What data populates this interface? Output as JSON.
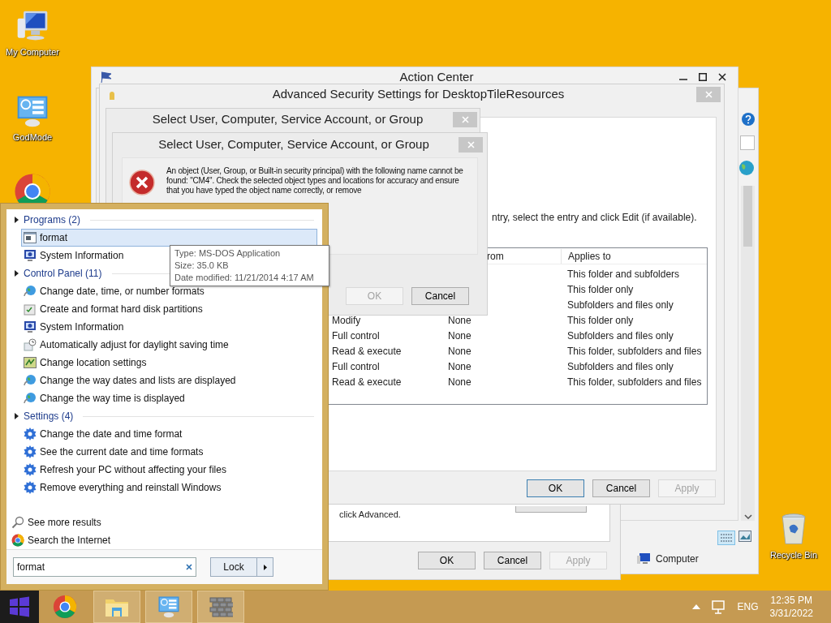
{
  "desktop_icons": [
    {
      "kind": "computer",
      "label": "My Computer"
    },
    {
      "kind": "godmode",
      "label": "GodMode"
    },
    {
      "kind": "chrome"
    },
    {
      "kind": "recycle",
      "label": "Recycle Bin"
    }
  ],
  "explorer_window": {
    "status_item": "Computer"
  },
  "action_center": {
    "title": "Action Center"
  },
  "properties_dialog": {
    "text": "click Advanced.",
    "buttons": [
      {
        "label": "OK",
        "disabled": false,
        "default": false
      },
      {
        "label": "Cancel",
        "disabled": false,
        "default": false
      },
      {
        "label": "Apply",
        "disabled": true,
        "default": false
      }
    ]
  },
  "advanced_security": {
    "title": "Advanced Security Settings for DesktopTileResources",
    "instruction": "ntry, select the entry and click Edit (if available).",
    "table": {
      "columns": [
        "rom",
        "Applies to"
      ],
      "rows": [
        {
          "applies_to": "This folder and subfolders"
        },
        {
          "applies_to": "This folder only"
        },
        {
          "applies_to": "Subfolders and files only"
        },
        {
          "access": "Modify",
          "inherited": "None",
          "applies_to": "This folder only"
        },
        {
          "access": "Full control",
          "inherited": "None",
          "applies_to": "Subfolders and files only"
        },
        {
          "access": "Read & execute",
          "inherited": "None",
          "applies_to": "This folder, subfolders and files"
        },
        {
          "access": "Full control",
          "inherited": "None",
          "applies_to": "Subfolders and files only"
        },
        {
          "access": "Read & execute",
          "inherited": "None",
          "applies_to": "This folder, subfolders and files"
        }
      ]
    },
    "buttons": [
      {
        "label": "OK",
        "disabled": false,
        "default": true
      },
      {
        "label": "Cancel",
        "disabled": false,
        "default": false
      },
      {
        "label": "Apply",
        "disabled": true,
        "default": false
      }
    ]
  },
  "select_dialog_back": {
    "title": "Select User, Computer, Service Account, or Group"
  },
  "select_dialog": {
    "title": "Select User, Computer, Service Account, or Group",
    "message": "An object (User, Group, or Built-in security principal) with the following name cannot be found: \"CM4\". Check the selected object types and locations for accuracy and ensure that you have typed the object name correctly, or remove",
    "buttons": [
      {
        "label": "OK",
        "disabled": true,
        "default": false
      },
      {
        "label": "Cancel",
        "disabled": false,
        "default": false
      }
    ]
  },
  "start_menu": {
    "groups": [
      {
        "label": "Programs (2)",
        "items": [
          {
            "label": "format",
            "kind": "program",
            "selected": true
          },
          {
            "label": "System Information",
            "kind": "sysinfo",
            "selected": false
          }
        ]
      },
      {
        "label": "Control Panel (11)",
        "items": [
          {
            "label": "Change date, time, or number formats",
            "kind": "globe",
            "selected": false
          },
          {
            "label": "Create and format hard disk partitions",
            "kind": "disk",
            "selected": false
          },
          {
            "label": "System Information",
            "kind": "sysinfo",
            "selected": false
          },
          {
            "label": "Automatically adjust for daylight saving time",
            "kind": "clock",
            "selected": false
          },
          {
            "label": "Change location settings",
            "kind": "location",
            "selected": false
          },
          {
            "label": "Change the way dates and lists are displayed",
            "kind": "globe",
            "selected": false
          },
          {
            "label": "Change the way time is displayed",
            "kind": "globe",
            "selected": false
          }
        ]
      },
      {
        "label": "Settings (4)",
        "items": [
          {
            "label": "Change the date and time format",
            "kind": "gear",
            "selected": false
          },
          {
            "label": "See the current date and time formats",
            "kind": "gear",
            "selected": false
          },
          {
            "label": "Refresh your PC without affecting your files",
            "kind": "gear",
            "selected": false
          },
          {
            "label": "Remove everything and reinstall Windows",
            "kind": "gear",
            "selected": false
          }
        ]
      }
    ],
    "links": [
      {
        "label": "See more results",
        "kind": "search"
      },
      {
        "label": "Search the Internet",
        "kind": "chrome"
      }
    ],
    "search": {
      "value": "format"
    },
    "power_button": "Lock"
  },
  "tooltip": [
    "Type: MS-DOS Application",
    "Size: 35.0 KB",
    "Date modified: 11/21/2014 4:17 AM"
  ],
  "taskbar": {
    "apps": [
      {
        "kind": "start",
        "running": false
      },
      {
        "kind": "chrome",
        "running": false
      },
      {
        "kind": "explorer",
        "running": true
      },
      {
        "kind": "godmode",
        "running": true
      },
      {
        "kind": "firewall",
        "running": true
      }
    ],
    "language": "ENG",
    "time": "12:35 PM",
    "date": "3/31/2022"
  }
}
